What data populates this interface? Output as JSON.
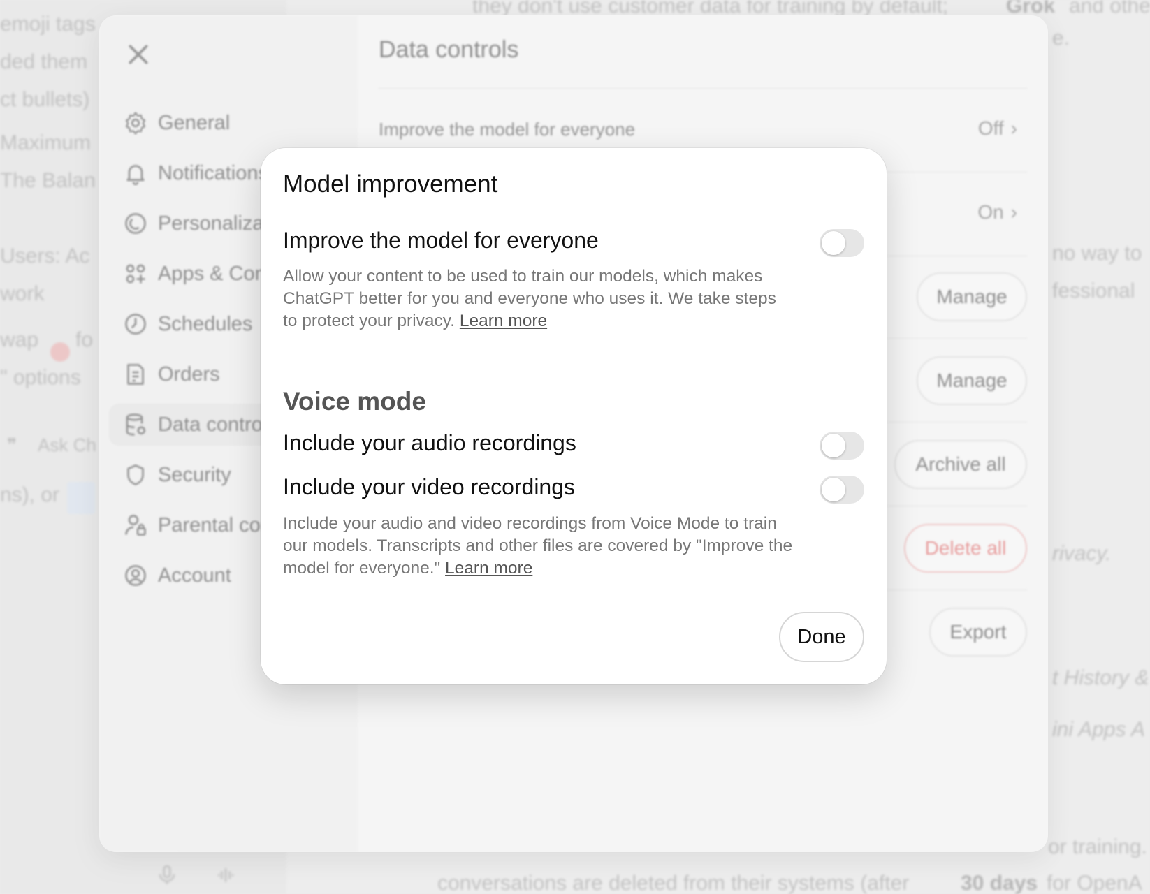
{
  "background_chat": {
    "fragments": [
      "emoji tags",
      "ded them",
      "ct bullets)",
      "Maximum",
      "The Balan",
      "Users: Ac",
      "work",
      "wap",
      "fo",
      "\" options",
      "Ask Ch",
      "ns), or",
      "they don't use customer data for training by default;",
      "Grok",
      "and othe",
      "e.",
      "no way to",
      "fessional",
      "rivacy.",
      "t History &",
      "ini Apps A",
      "or training.",
      "conversations are deleted from their systems (after",
      "30 days",
      "for OpenA"
    ]
  },
  "settings": {
    "title": "Data controls",
    "nav": [
      {
        "label": "General",
        "icon": "gear-icon"
      },
      {
        "label": "Notifications",
        "icon": "bell-icon"
      },
      {
        "label": "Personalization",
        "icon": "personalization-icon"
      },
      {
        "label": "Apps & Connectors",
        "icon": "apps-icon"
      },
      {
        "label": "Schedules",
        "icon": "clock-icon"
      },
      {
        "label": "Orders",
        "icon": "receipt-icon"
      },
      {
        "label": "Data controls",
        "icon": "database-icon",
        "active": true
      },
      {
        "label": "Security",
        "icon": "shield-icon"
      },
      {
        "label": "Parental controls",
        "icon": "parental-icon"
      },
      {
        "label": "Account",
        "icon": "account-icon"
      }
    ],
    "rows": [
      {
        "label": "Improve the model for everyone",
        "value": "Off"
      },
      {
        "value": "On"
      }
    ],
    "buttons": {
      "manage_1": "Manage",
      "manage_2": "Manage",
      "archive_all": "Archive all",
      "delete_all": "Delete all",
      "export": "Export"
    },
    "accent_danger": "#e04040"
  },
  "modal": {
    "title": "Model improvement",
    "improve": {
      "label": "Improve the model for everyone",
      "toggle_on": false,
      "description": "Allow your content to be used to train our models, which makes ChatGPT better for you and everyone who uses it. We take steps to protect your privacy.",
      "link": "Learn more"
    },
    "voice_section": "Voice mode",
    "audio": {
      "label": "Include your audio recordings",
      "toggle_on": false
    },
    "video": {
      "label": "Include your video recordings",
      "toggle_on": false
    },
    "voice_description": "Include your audio and video recordings from Voice Mode to train our models. Transcripts and other files are covered by \"Improve the model for everyone.\"",
    "voice_link": "Learn more",
    "done_label": "Done"
  }
}
